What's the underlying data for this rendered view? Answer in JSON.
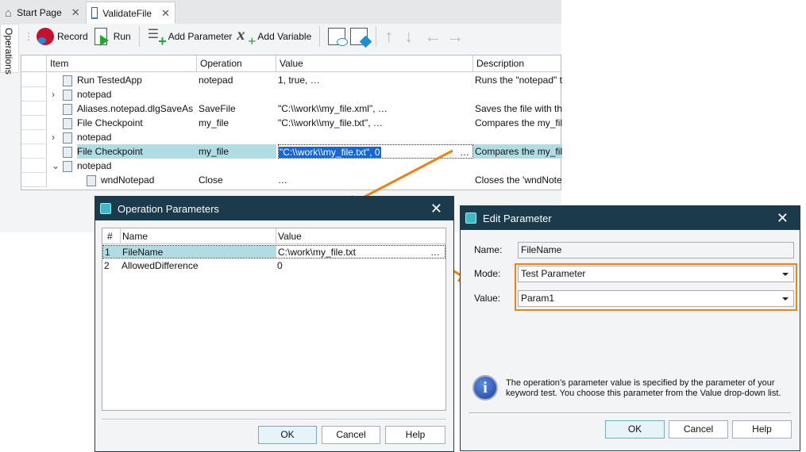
{
  "tabs": [
    {
      "label": "Start Page"
    },
    {
      "label": "ValidateFile"
    }
  ],
  "side_tab": "Operations",
  "toolbar": {
    "record": "Record",
    "run": "Run",
    "add_parameter": "Add Parameter",
    "add_variable": "Add Variable"
  },
  "grid": {
    "headers": [
      "Item",
      "Operation",
      "Value",
      "Description"
    ],
    "rows": [
      {
        "item": "Run TestedApp",
        "operation": "notepad",
        "value": "1, true, …",
        "description": "Runs the \"notepad\" tes"
      },
      {
        "item": "notepad",
        "operation": "",
        "value": "",
        "description": ""
      },
      {
        "item": "Aliases.notepad.dlgSaveAs",
        "operation": "SaveFile",
        "value": "\"C:\\\\work\\\\my_file.xml\", …",
        "description": "Saves the file with the"
      },
      {
        "item": "File Checkpoint",
        "operation": "my_file",
        "value": "\"C:\\\\work\\\\my_file.txt\", …",
        "description": "Compares the my_file S"
      },
      {
        "item": "notepad",
        "operation": "",
        "value": "",
        "description": ""
      },
      {
        "item": "File Checkpoint",
        "operation": "my_file",
        "value": "\"C:\\\\work\\\\my_file.txt\", 0",
        "description": "Compares the my_file S"
      },
      {
        "item": "notepad",
        "operation": "",
        "value": "",
        "description": ""
      },
      {
        "item": "wndNotepad",
        "operation": "Close",
        "value": "…",
        "description": "Closes the 'wndNotepa"
      }
    ]
  },
  "op_params": {
    "title": "Operation Parameters",
    "headers": [
      "#",
      "Name",
      "Value"
    ],
    "rows": [
      {
        "n": "1",
        "name": "FileName",
        "value": "C:\\work\\my_file.txt"
      },
      {
        "n": "2",
        "name": "AllowedDifference",
        "value": "0"
      }
    ],
    "ok": "OK",
    "cancel": "Cancel",
    "help": "Help"
  },
  "edit_param": {
    "title": "Edit Parameter",
    "name_label": "Name:",
    "name_value": "FileName",
    "mode_label": "Mode:",
    "mode_value": "Test Parameter",
    "value_label": "Value:",
    "value_value": "Param1",
    "info": "The operation’s parameter value is specified by the parameter of your keyword test. You choose this parameter from the Value drop-down list.",
    "ok": "OK",
    "cancel": "Cancel",
    "help": "Help"
  },
  "colors": {
    "accent": "#f08010",
    "titlebar": "#1b3a4b",
    "selection": "#b0dce4"
  }
}
